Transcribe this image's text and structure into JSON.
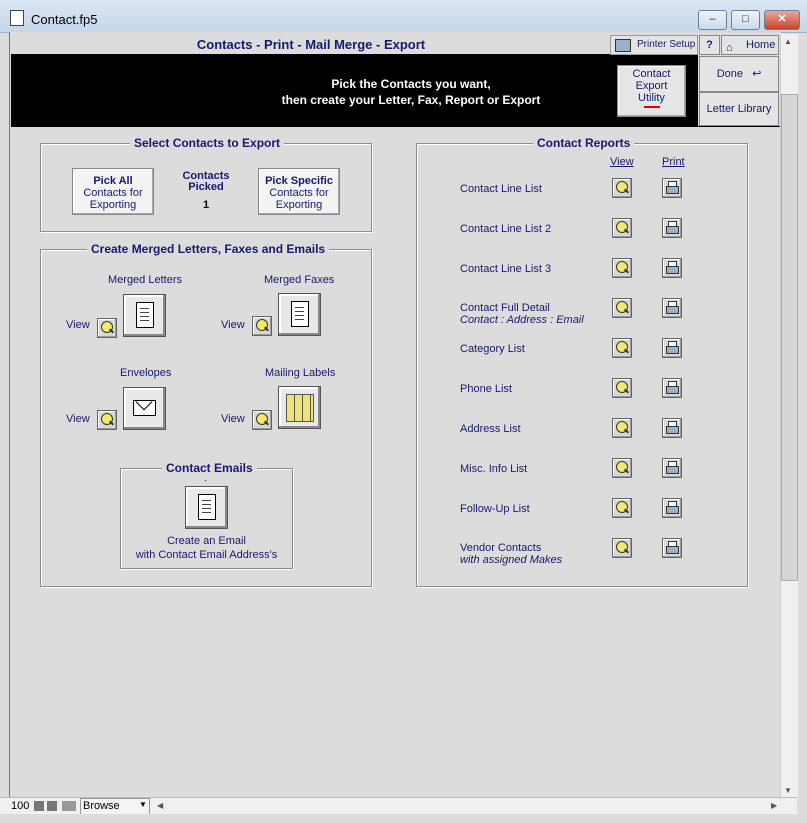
{
  "window": {
    "title": "Contact.fp5",
    "minimize": "–",
    "maximize": "□",
    "close": "✕"
  },
  "header": {
    "title": "Contacts - Print - Mail Merge - Export",
    "printer_setup": "Printer Setup",
    "help": "?",
    "home": "Home"
  },
  "band": {
    "line1": "Pick the Contacts you want,",
    "line2": "then create your Letter, Fax, Report or Export"
  },
  "export_utility": {
    "line1": "Contact",
    "line2": "Export",
    "line3": "Utility"
  },
  "right": {
    "done": "Done",
    "letter_library": "Letter Library"
  },
  "select_contacts": {
    "title": "Select Contacts to Export",
    "pick_all_bold": "Pick All",
    "pick_all_l2": "Contacts for",
    "pick_all_l3": "Exporting",
    "picked_l1": "Contacts",
    "picked_l2": "Picked",
    "picked_count": "1",
    "pick_specific_bold": "Pick Specific",
    "pick_specific_l2": "Contacts for",
    "pick_specific_l3": "Exporting"
  },
  "merge": {
    "title": "Create Merged Letters, Faxes and Emails",
    "letters": "Merged Letters",
    "faxes": "Merged Faxes",
    "envelopes": "Envelopes",
    "labels": "Mailing Labels",
    "view": "View"
  },
  "emails": {
    "title": "Contact Emails",
    "dot": ".",
    "l1": "Create an Email",
    "l2": "with Contact Email Address's"
  },
  "reports": {
    "title": "Contact Reports",
    "col_view": "View",
    "col_print": "Print",
    "items": [
      {
        "label": "Contact Line List",
        "sub": ""
      },
      {
        "label": "Contact Line List 2",
        "sub": ""
      },
      {
        "label": "Contact Line List 3",
        "sub": ""
      },
      {
        "label": "Contact Full Detail",
        "sub": "Contact : Address : Email"
      },
      {
        "label": "Category List",
        "sub": ""
      },
      {
        "label": "Phone List",
        "sub": ""
      },
      {
        "label": "Address List",
        "sub": ""
      },
      {
        "label": "Misc. Info List",
        "sub": ""
      },
      {
        "label": "Follow-Up List",
        "sub": ""
      },
      {
        "label": "Vendor Contacts",
        "sub": "with assigned Makes"
      }
    ]
  },
  "statusbar": {
    "zoom": "100",
    "mode": "Browse"
  },
  "colors": {
    "accent": "#161a6e",
    "band": "#000000",
    "background": "#dcdcdc"
  }
}
